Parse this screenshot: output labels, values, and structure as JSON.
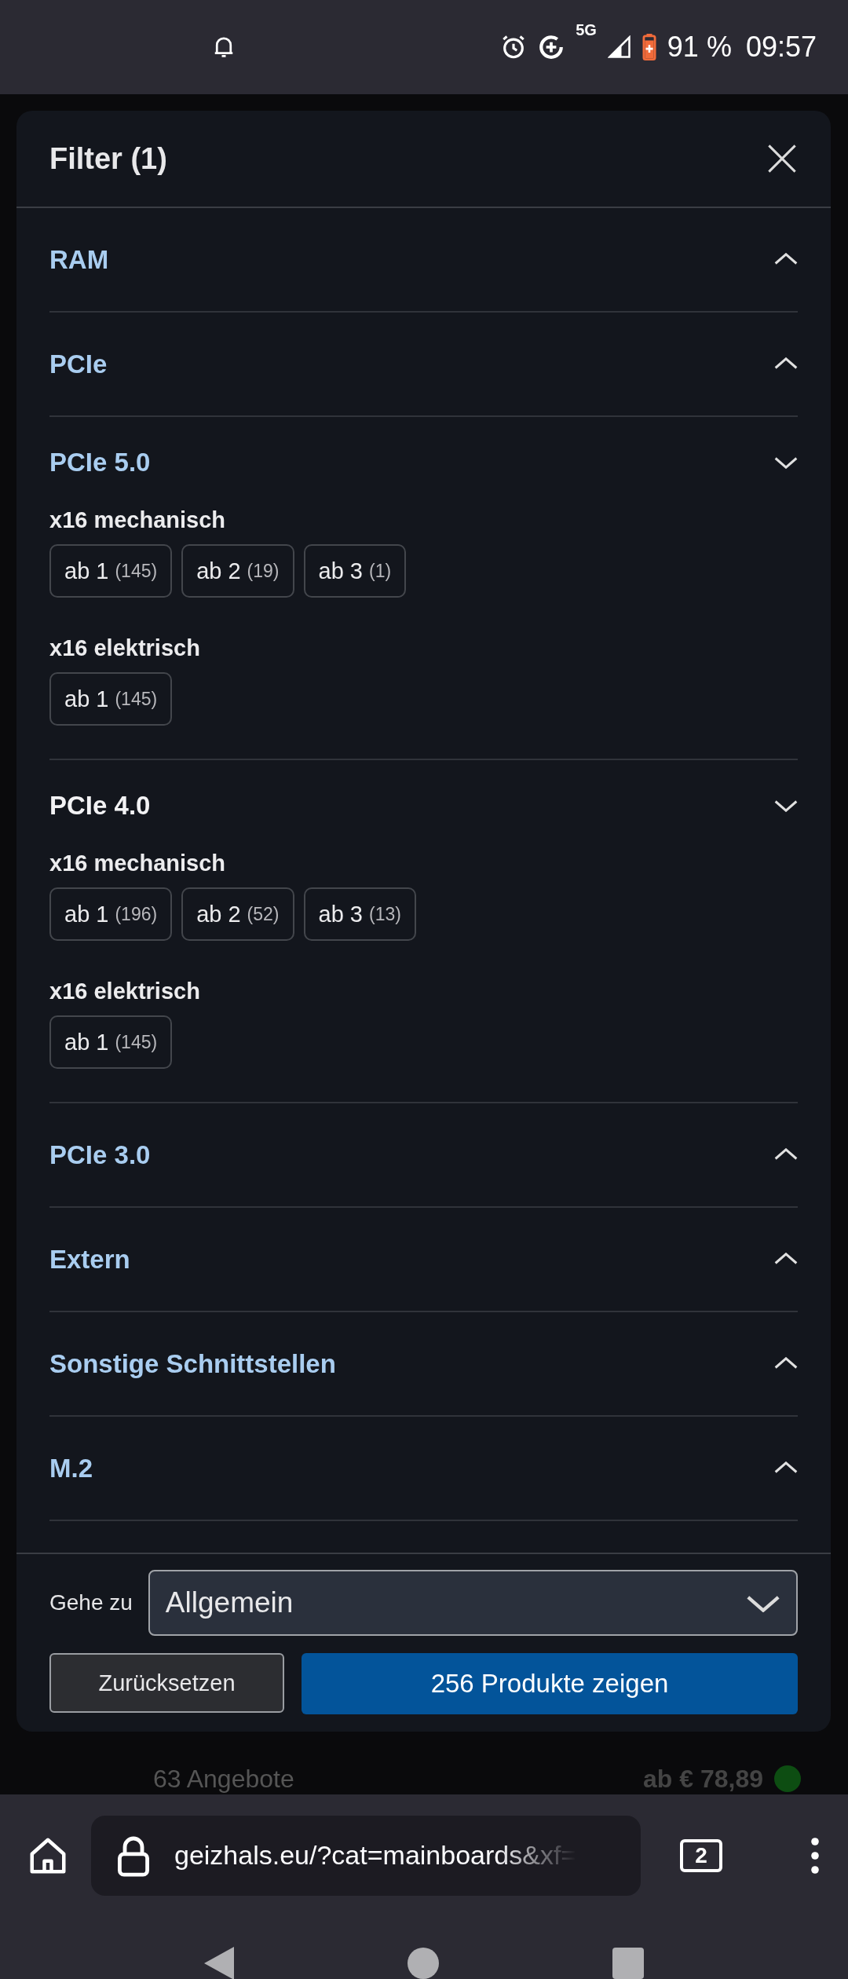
{
  "status_bar": {
    "network": "5G",
    "battery": "91 %",
    "time": "09:57"
  },
  "filter": {
    "title": "Filter (1)",
    "sections": [
      {
        "title": "RAM",
        "expanded": false,
        "highlighted": false
      },
      {
        "title": "PCIe",
        "expanded": false,
        "highlighted": false
      },
      {
        "title": "PCIe 5.0",
        "expanded": true,
        "highlighted": false,
        "groups": [
          {
            "title": "x16 mechanisch",
            "options": [
              {
                "label": "ab 1",
                "count": "(145)"
              },
              {
                "label": "ab 2",
                "count": "(19)"
              },
              {
                "label": "ab 3",
                "count": "(1)"
              }
            ]
          },
          {
            "title": "x16 elektrisch",
            "options": [
              {
                "label": "ab 1",
                "count": "(145)"
              }
            ]
          }
        ]
      },
      {
        "title": "PCIe 4.0",
        "expanded": true,
        "highlighted": true,
        "groups": [
          {
            "title": "x16 mechanisch",
            "options": [
              {
                "label": "ab 1",
                "count": "(196)"
              },
              {
                "label": "ab 2",
                "count": "(52)"
              },
              {
                "label": "ab 3",
                "count": "(13)"
              }
            ]
          },
          {
            "title": "x16 elektrisch",
            "options": [
              {
                "label": "ab 1",
                "count": "(145)"
              }
            ]
          }
        ]
      },
      {
        "title": "PCIe 3.0",
        "expanded": false,
        "highlighted": false
      },
      {
        "title": "Extern",
        "expanded": false,
        "highlighted": false
      },
      {
        "title": "Sonstige Schnittstellen",
        "expanded": false,
        "highlighted": false
      },
      {
        "title": "M.2",
        "expanded": false,
        "highlighted": false
      }
    ]
  },
  "footer": {
    "goto_label": "Gehe zu",
    "goto_value": "Allgemein",
    "reset_button": "Zurücksetzen",
    "show_button": "256 Produkte zeigen"
  },
  "background": {
    "offers": "63 Angebote",
    "price": "ab € 78,89"
  },
  "browser": {
    "url": "geizhals.eu/?cat=mainboards&xf=",
    "tab_count": "2"
  }
}
